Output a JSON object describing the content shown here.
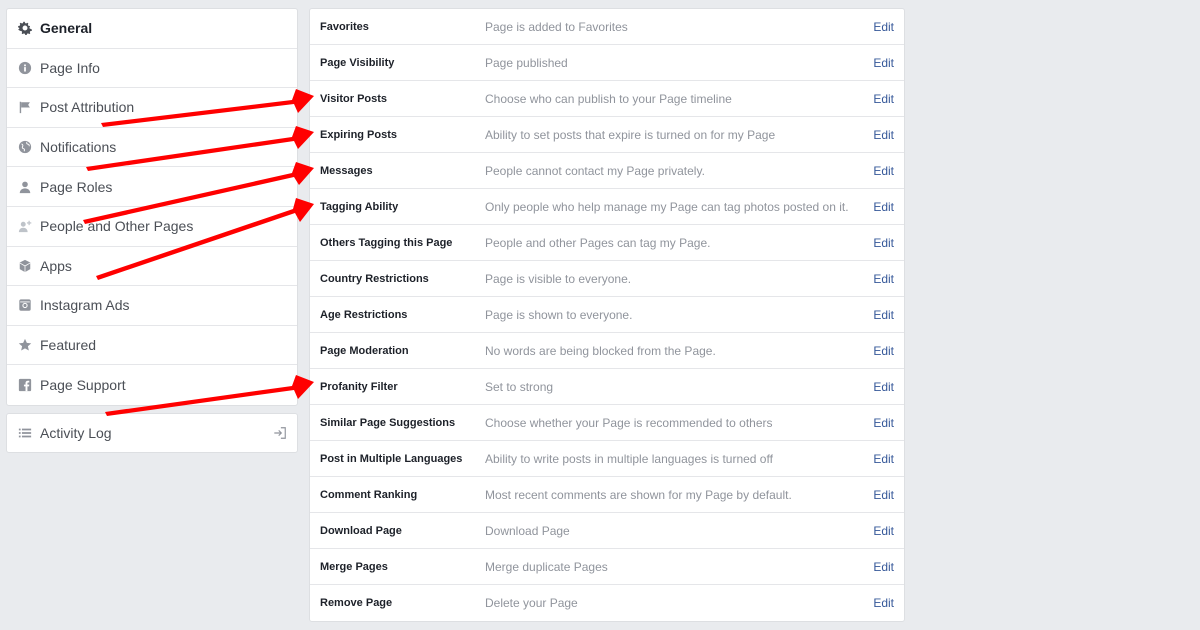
{
  "sidebar": {
    "items": [
      {
        "label": "General",
        "icon": "gear-icon"
      },
      {
        "label": "Page Info",
        "icon": "info-icon"
      },
      {
        "label": "Post Attribution",
        "icon": "flag-icon"
      },
      {
        "label": "Notifications",
        "icon": "globe-icon"
      },
      {
        "label": "Page Roles",
        "icon": "person-icon"
      },
      {
        "label": "People and Other Pages",
        "icon": "person-plus-icon"
      },
      {
        "label": "Apps",
        "icon": "cube-icon"
      },
      {
        "label": "Instagram Ads",
        "icon": "camera-icon"
      },
      {
        "label": "Featured",
        "icon": "star-icon"
      },
      {
        "label": "Page Support",
        "icon": "facebook-icon"
      }
    ],
    "activity_log": {
      "label": "Activity Log",
      "icon": "list-icon",
      "action_icon": "exit-icon"
    }
  },
  "settings": {
    "edit_label": "Edit",
    "rows": [
      {
        "label": "Favorites",
        "value": "Page is added to Favorites"
      },
      {
        "label": "Page Visibility",
        "value": "Page published"
      },
      {
        "label": "Visitor Posts",
        "value": "Choose who can publish to your Page timeline"
      },
      {
        "label": "Expiring Posts",
        "value": "Ability to set posts that expire is turned on for my Page"
      },
      {
        "label": "Messages",
        "value": "People cannot contact my Page privately."
      },
      {
        "label": "Tagging Ability",
        "value": "Only people who help manage my Page can tag photos posted on it."
      },
      {
        "label": "Others Tagging this Page",
        "value": "People and other Pages can tag my Page."
      },
      {
        "label": "Country Restrictions",
        "value": "Page is visible to everyone."
      },
      {
        "label": "Age Restrictions",
        "value": "Page is shown to everyone."
      },
      {
        "label": "Page Moderation",
        "value": "No words are being blocked from the Page."
      },
      {
        "label": "Profanity Filter",
        "value": "Set to strong"
      },
      {
        "label": "Similar Page Suggestions",
        "value": "Choose whether your Page is recommended to others"
      },
      {
        "label": "Post in Multiple Languages",
        "value": "Ability to write posts in multiple languages is turned off"
      },
      {
        "label": "Comment Ranking",
        "value": "Most recent comments are shown for my Page by default."
      },
      {
        "label": "Download Page",
        "value": "Download Page"
      },
      {
        "label": "Merge Pages",
        "value": "Merge duplicate Pages"
      },
      {
        "label": "Remove Page",
        "value": "Delete your Page"
      }
    ]
  },
  "colors": {
    "background": "#e9ebee",
    "link": "#365899",
    "muted_text": "#90949c",
    "annotation_arrow": "#ff0000"
  }
}
